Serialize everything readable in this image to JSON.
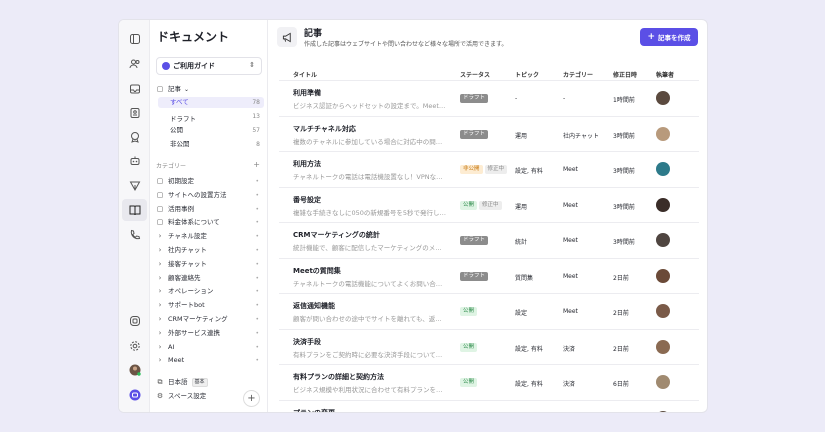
{
  "sidebar": {
    "title": "ドキュメント",
    "guide_label": "ご利用ガイド",
    "articles_label": "記事",
    "items": [
      {
        "label": "すべて",
        "count": "78"
      },
      {
        "label": "ドラフト",
        "count": "13"
      },
      {
        "label": "公開",
        "count": "57"
      },
      {
        "label": "非公開",
        "count": "8"
      }
    ],
    "category_heading": "カテゴリー",
    "categories": [
      "初期設定",
      "サイトへの設置方法",
      "活用事例",
      "料金体系について",
      "チャネル設定",
      "社内チャット",
      "接客チャット",
      "顧客連絡先",
      "オペレーション",
      "サポートbot",
      "CRMマーケティング",
      "外部サービス連携",
      "AI",
      "Meet"
    ],
    "language_label": "日本語",
    "language_badge": "基本",
    "space_settings_label": "スペース設定"
  },
  "header": {
    "title": "記事",
    "subtitle": "作成した記事はウェブサイトや問い合わせなど様々な場所で活用できます。",
    "create_label": "記事を作成"
  },
  "table": {
    "columns": [
      "タイトル",
      "ステータス",
      "トピック",
      "カテゴリー",
      "修正日時",
      "執筆者"
    ],
    "rows": [
      {
        "title": "利用準備",
        "desc": "ビジネス認証からヘッドセットの設定まで。Meet…",
        "status": "ドラフト",
        "status_type": "draft",
        "edit": "",
        "topic": "-",
        "category": "-",
        "date": "1時間前",
        "avatar": "#5b4a3f"
      },
      {
        "title": "マルチチャネル対応",
        "desc": "複数のチャネルに参加している場合に対応中の問…",
        "status": "ドラフト",
        "status_type": "draft",
        "edit": "",
        "topic": "運用",
        "category": "社内チャット",
        "date": "3時間前",
        "avatar": "#b89a7c"
      },
      {
        "title": "利用方法",
        "desc": "チャネルトークの電話は電話機設置なし！VPNな…",
        "status": "非公開",
        "status_type": "priv",
        "edit": "修正中",
        "topic": "設定, 有料",
        "category": "Meet",
        "date": "3時間前",
        "avatar": "#2d7a8a"
      },
      {
        "title": "番号設定",
        "desc": "複雑な手続きなしに050の新規番号を5秒で発行し…",
        "status": "公開",
        "status_type": "pub",
        "edit": "修正中",
        "topic": "運用",
        "category": "Meet",
        "date": "3時間前",
        "avatar": "#3a2d28"
      },
      {
        "title": "CRMマーケティングの統計",
        "desc": "統計機能で、顧客に配信したマーケティングのメ…",
        "status": "ドラフト",
        "status_type": "draft",
        "edit": "",
        "topic": "統計",
        "category": "Meet",
        "date": "3時間前",
        "avatar": "#4f4540"
      },
      {
        "title": "Meetの質問集",
        "desc": "チャネルトークの電話機能についてよくお問い合…",
        "status": "ドラフト",
        "status_type": "draft",
        "edit": "",
        "topic": "質問集",
        "category": "Meet",
        "date": "2日前",
        "avatar": "#6b4a38"
      },
      {
        "title": "返信通知機能",
        "desc": "顧客が問い合わせの途中でサイトを離れても、返…",
        "status": "公開",
        "status_type": "pub",
        "edit": "",
        "topic": "設定",
        "category": "Meet",
        "date": "2日前",
        "avatar": "#7a5a48"
      },
      {
        "title": "決済手段",
        "desc": "有料プランをご契約時に必要な決済手段について…",
        "status": "公開",
        "status_type": "pub",
        "edit": "",
        "topic": "設定, 有料",
        "category": "決済",
        "date": "2日前",
        "avatar": "#8a6a52"
      },
      {
        "title": "有料プランの詳細と契約方法",
        "desc": "ビジネス規模や利用状況に合わせて有料プランを…",
        "status": "公開",
        "status_type": "pub",
        "edit": "",
        "topic": "設定, 有料",
        "category": "決済",
        "date": "6日前",
        "avatar": "#a08a70"
      },
      {
        "title": "プランの変更",
        "desc": "",
        "status": "",
        "status_type": "",
        "edit": "",
        "topic": "",
        "category": "",
        "date": "",
        "avatar": "#5a4a40"
      }
    ]
  },
  "colors": {
    "accent": "#5b4fe6",
    "draft": "#8c8c8c",
    "published": "#2d8a4a",
    "private": "#c77a14"
  }
}
